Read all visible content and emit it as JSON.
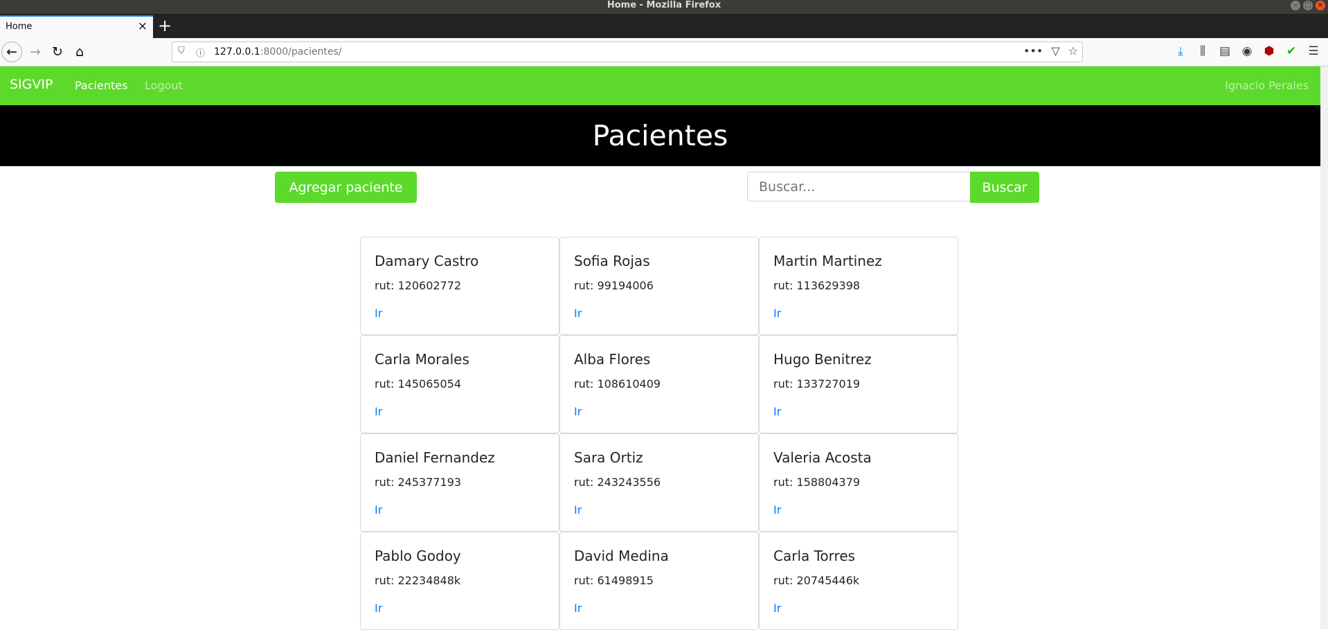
{
  "os": {
    "window_title": "Home - Mozilla Firefox"
  },
  "browser": {
    "tab_title": "Home",
    "url_host": "127.0.0.1",
    "url_rest": ":8000/pacientes/"
  },
  "app": {
    "brand": "SIGVIP",
    "nav": {
      "pacientes": "Pacientes",
      "logout": "Logout",
      "user": "Ignacio Perales"
    },
    "page_title": "Pacientes",
    "add_button": "Agregar paciente",
    "search": {
      "placeholder": "Buscar...",
      "button": "Buscar"
    }
  },
  "patients": [
    {
      "name": "Damary Castro",
      "rut": "rut: 120602772",
      "link": "Ir"
    },
    {
      "name": "Sofia Rojas",
      "rut": "rut: 99194006",
      "link": "Ir"
    },
    {
      "name": "Martin Martinez",
      "rut": "rut: 113629398",
      "link": "Ir"
    },
    {
      "name": "Carla Morales",
      "rut": "rut: 145065054",
      "link": "Ir"
    },
    {
      "name": "Alba Flores",
      "rut": "rut: 108610409",
      "link": "Ir"
    },
    {
      "name": "Hugo Benitrez",
      "rut": "rut: 133727019",
      "link": "Ir"
    },
    {
      "name": "Daniel Fernandez",
      "rut": "rut: 245377193",
      "link": "Ir"
    },
    {
      "name": "Sara Ortiz",
      "rut": "rut: 243243556",
      "link": "Ir"
    },
    {
      "name": "Valeria Acosta",
      "rut": "rut: 158804379",
      "link": "Ir"
    },
    {
      "name": "Pablo Godoy",
      "rut": "rut: 22234848k",
      "link": "Ir"
    },
    {
      "name": "David Medina",
      "rut": "rut: 61498915",
      "link": "Ir"
    },
    {
      "name": "Carla Torres",
      "rut": "rut: 20745446k",
      "link": "Ir"
    }
  ],
  "colors": {
    "brand_green": "#5cd92a",
    "header_black": "#000000",
    "link_blue": "#007bff"
  }
}
